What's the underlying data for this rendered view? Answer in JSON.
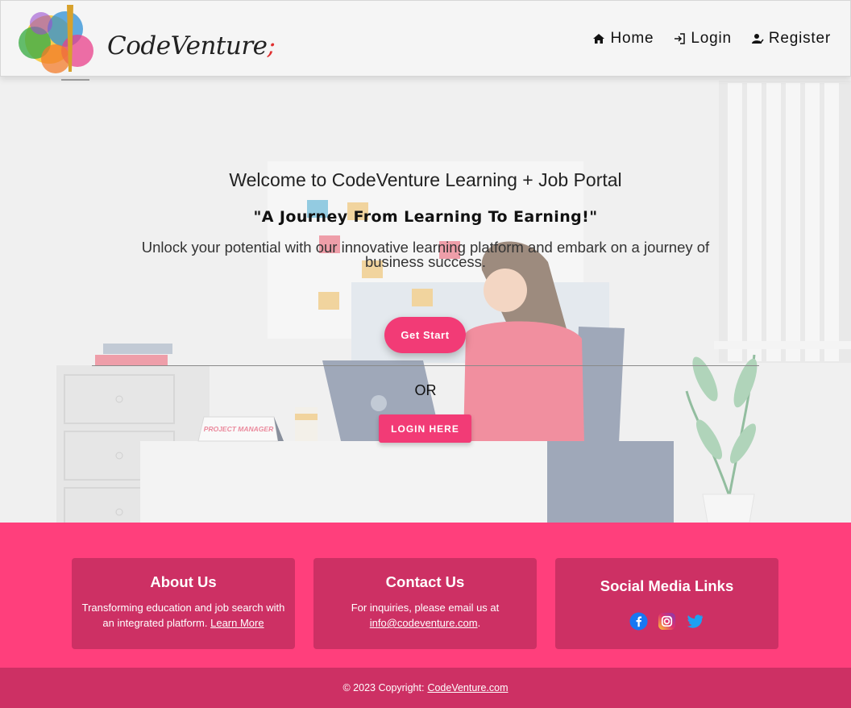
{
  "header": {
    "logo_text": "CodeVenture",
    "logo_suffix": ";",
    "nav": [
      {
        "label": "Home",
        "icon": "home-icon"
      },
      {
        "label": "Login",
        "icon": "login-icon"
      },
      {
        "label": "Register",
        "icon": "register-icon"
      }
    ]
  },
  "hero": {
    "title": "Welcome to CodeVenture Learning + Job Portal",
    "subtitle": "\"A Journey From Learning To Earning!\"",
    "description": "Unlock your potential with our innovative learning platform and embark on a journey of business success.",
    "get_start_label": "Get Start",
    "or_text": "OR",
    "login_here_label": "LOGIN HERE",
    "illustration_nameplate": "PROJECT MANAGER"
  },
  "footer": {
    "about": {
      "title": "About Us",
      "text": "Transforming education and job search with an integrated platform.",
      "link": "Learn More"
    },
    "contact": {
      "title": "Contact Us",
      "text": "For inquiries, please email us at",
      "email": "info@codeventure.com",
      "period": "."
    },
    "social": {
      "title": "Social Media Links",
      "icons": [
        "facebook-icon",
        "instagram-icon",
        "twitter-icon"
      ]
    },
    "copyright_prefix": "© 2023 Copyright:",
    "copyright_link": "CodeVenture.com"
  },
  "colors": {
    "accent": "#f23b76",
    "footer_bg": "#ff3f7c",
    "footer_card": "#cd3064"
  }
}
